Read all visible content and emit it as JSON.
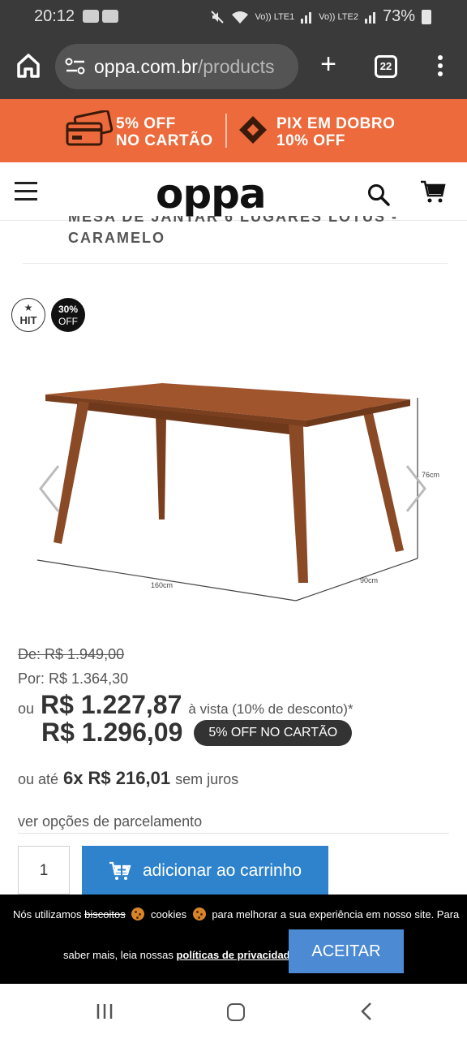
{
  "status_bar": {
    "time": "20:12",
    "signal_1": "Vo)) LTE1",
    "signal_2": "Vo)) LTE2",
    "battery": "73%"
  },
  "browser": {
    "url_host": "oppa.com.br",
    "url_path": "/products",
    "tab_count": "22",
    "new_tab_label": "+"
  },
  "promo": {
    "card_line1": "5% OFF",
    "card_line2": "NO CARTÃO",
    "pix_line1": "PIX EM DOBRO",
    "pix_line2": "10% OFF",
    "background_color": "#ec6a3b"
  },
  "header": {
    "logo": "oppa"
  },
  "product": {
    "title_line1": "MESA DE JANTAR 6 LUGARES LOTUS -",
    "title_line2": "CARAMELO",
    "badge_hit": "HIT",
    "badge_off_pct": "30%",
    "badge_off_label": "OFF",
    "dim_height": "76cm",
    "dim_length": "160cm",
    "dim_depth": "90cm",
    "wood_color": "#8b4a26"
  },
  "pricing": {
    "de": "De: R$ 1.949,00",
    "por": "Por: R$ 1.364,30",
    "ou": "ou",
    "vista_price": "R$ 1.227,87",
    "vista_desc": "à vista (10% de desconto)*",
    "card_price": "R$ 1.296,09",
    "card_badge": "5% OFF NO CARTÃO",
    "install_prefix": "ou até",
    "install_count": "6x",
    "install_value": "R$ 216,01",
    "install_suffix": "sem juros",
    "ver_opcoes": "ver opções de parcelamento"
  },
  "cart": {
    "quantity": "1",
    "add_label": "adicionar ao carrinho",
    "button_color": "#2e83cc"
  },
  "cookie": {
    "text_a": "Nós utilizamos",
    "text_strike": "biscoitos",
    "text_b": "cookies",
    "text_c": "para melhorar a sua experiência em nosso site. Para",
    "text_d": "saber mais, leia nossas",
    "policy_link": "políticas de privacidade",
    "accept": "ACEITAR"
  }
}
